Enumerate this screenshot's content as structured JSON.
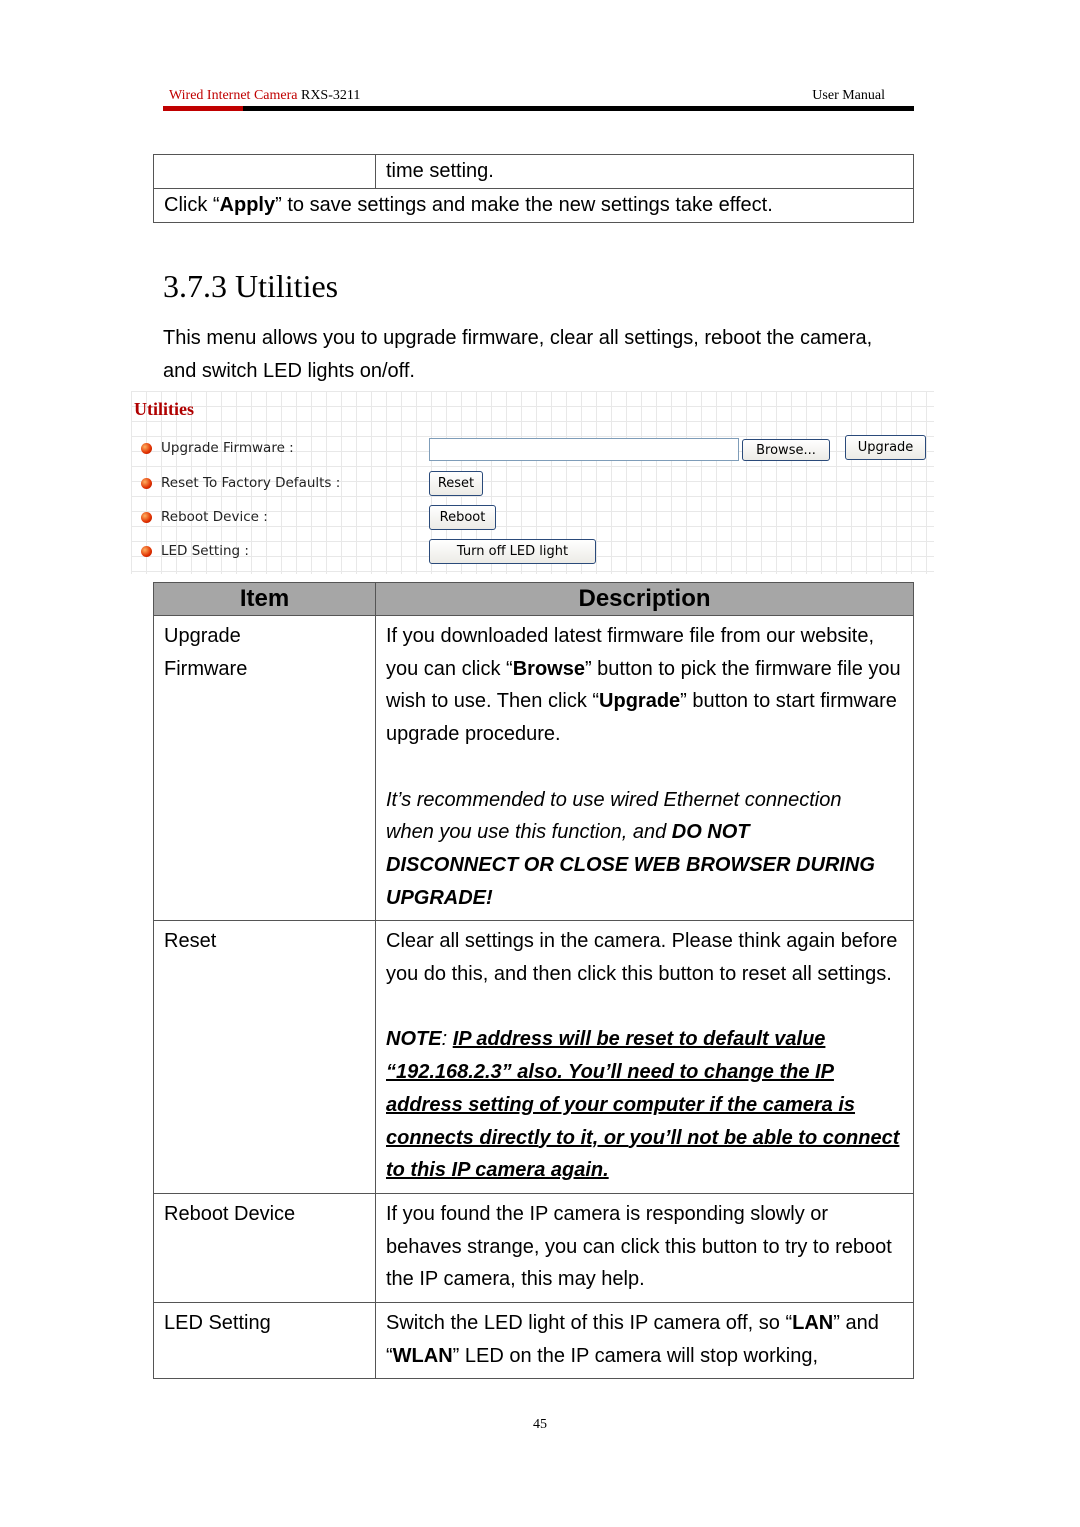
{
  "header": {
    "product_red": "Wired Internet Camera",
    "model": "RXS-3211",
    "doc_type": "User Manual",
    "accent_color": "#c00000"
  },
  "top_table": {
    "row1_desc": "time setting.",
    "row2_pre": "Click “",
    "row2_bold": "Apply",
    "row2_post": "” to save settings and make the new settings take effect."
  },
  "section": {
    "title": "3.7.3 Utilities",
    "intro": "This menu allows you to upgrade firmware, clear all settings, reboot the camera, and switch LED lights on/off."
  },
  "ui": {
    "title": "Utilities",
    "rows": [
      {
        "label": "Upgrade Firmware :"
      },
      {
        "label": "Reset To Factory Defaults :"
      },
      {
        "label": "Reboot Device :"
      },
      {
        "label": "LED Setting :"
      }
    ],
    "file_input_value": "",
    "browse_label": "Browse...",
    "upgrade_label": "Upgrade",
    "reset_label": "Reset",
    "reboot_label": "Reboot",
    "led_label": "Turn off LED light"
  },
  "table": {
    "headers": [
      "Item",
      "Description"
    ],
    "rows": [
      {
        "item": "Upgrade Firmware",
        "d1": "If you downloaded latest firmware file from our website, you can click “",
        "d1b": "Browse",
        "d2": "” button to pick the firmware file you wish to use. Then click “",
        "d2b": "Upgrade",
        "d3": "” button to start firmware upgrade procedure.",
        "note_it": "It’s recommended to use wired Ethernet connection when you use this function, and ",
        "note_bold": "DO NOT DISCONNECT OR CLOSE WEB BROWSER DURING UPGRADE!"
      },
      {
        "item": "Reset",
        "d1": "Clear all settings in the camera. Please think again before you do this, and then click this button to reset all settings.",
        "note_label": "NOTE",
        "note_colon": ": ",
        "note_ul": "IP address will be reset to default value “192.168.2.3” also. You’ll need to change the IP address setting of your computer if the camera is connects directly to it, or you’ll not be able to connect to this IP camera again."
      },
      {
        "item": "Reboot Device",
        "d1": "If you found the IP camera is responding slowly or behaves strange, you can click this button to try to reboot the IP camera, this may help."
      },
      {
        "item": "LED Setting",
        "d1": "Switch the LED light of this IP camera off, so “",
        "d1b": "LAN",
        "d2": "” and “",
        "d2b": "WLAN",
        "d3": "” LED on the IP camera will stop working,"
      }
    ]
  },
  "footer": {
    "page_number": "45"
  }
}
